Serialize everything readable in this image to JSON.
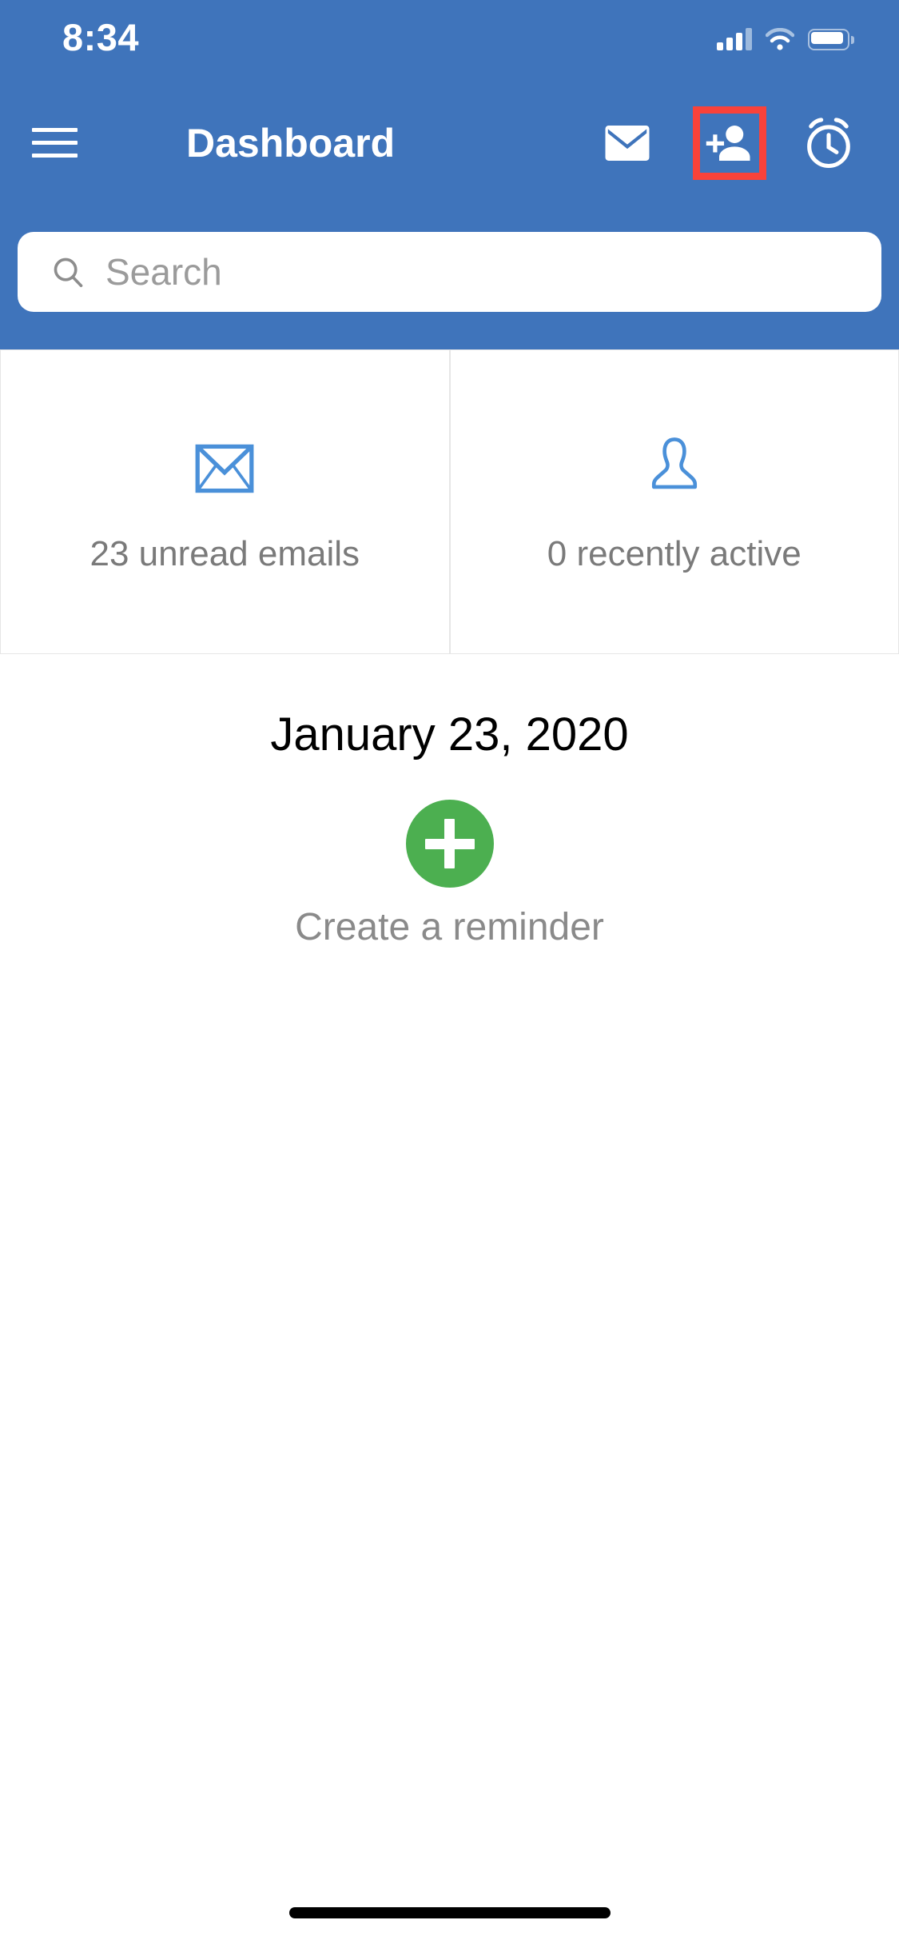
{
  "status_bar": {
    "time": "8:34",
    "cellular_icon": "cellular-signal-icon",
    "wifi_icon": "wifi-icon",
    "battery_icon": "battery-icon"
  },
  "navbar": {
    "menu_icon": "hamburger-menu-icon",
    "title": "Dashboard",
    "actions": [
      {
        "icon": "mail-icon",
        "highlighted": false
      },
      {
        "icon": "person-add-icon",
        "highlighted": true
      },
      {
        "icon": "alarm-clock-icon",
        "highlighted": false
      }
    ],
    "highlight_color": "#f9423a"
  },
  "search": {
    "icon": "search-icon",
    "placeholder": "Search",
    "value": ""
  },
  "cards": [
    {
      "icon": "envelope-outline-icon",
      "label": "23 unread emails",
      "count": 23
    },
    {
      "icon": "person-outline-icon",
      "label": "0 recently active",
      "count": 0
    }
  ],
  "date": {
    "text": "January 23, 2020"
  },
  "reminder": {
    "button_icon": "plus-icon",
    "label": "Create a reminder",
    "button_color": "#4caf50"
  },
  "theme": {
    "header_blue": "#3f74bb",
    "accent_green": "#4caf50",
    "icon_blue": "#4a90d9",
    "muted_text": "#7a7a7a"
  },
  "home_indicator": {
    "name": "home-indicator"
  }
}
